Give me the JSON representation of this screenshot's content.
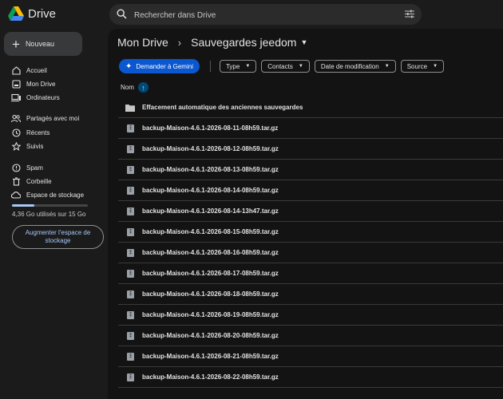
{
  "app": {
    "name": "Drive",
    "logo_colors": [
      "#0f9d58",
      "#fbbc04",
      "#4285f4",
      "#ea4335"
    ]
  },
  "search": {
    "placeholder": "Rechercher dans Drive",
    "icon": "search-icon",
    "options_icon": "tune-icon"
  },
  "sidebar": {
    "new_label": "Nouveau",
    "items": [
      {
        "label": "Accueil",
        "icon": "home-icon"
      },
      {
        "label": "Mon Drive",
        "icon": "my-drive-icon"
      },
      {
        "label": "Ordinateurs",
        "icon": "computers-icon"
      },
      {
        "label": "Partagés avec moi",
        "icon": "shared-icon"
      },
      {
        "label": "Récents",
        "icon": "clock-icon"
      },
      {
        "label": "Suivis",
        "icon": "star-icon"
      },
      {
        "label": "Spam",
        "icon": "spam-icon"
      },
      {
        "label": "Corbeille",
        "icon": "trash-icon"
      },
      {
        "label": "Espace de stockage",
        "icon": "cloud-icon"
      }
    ],
    "storage": {
      "used_text": "4,36 Go utilisés sur 15 Go",
      "used_fraction": 0.29
    },
    "upgrade_label": "Augmenter l'espace de stockage"
  },
  "breadcrumb": {
    "root": "Mon Drive",
    "separator": "›",
    "current": "Sauvegardes jeedom"
  },
  "filters": {
    "gemini_label": "Demander à Gemini",
    "chips": [
      "Type",
      "Contacts",
      "Date de modification",
      "Source"
    ]
  },
  "table": {
    "name_header": "Nom",
    "rows": [
      {
        "name": "Effacement automatique des anciennes sauvegardes",
        "kind": "folder"
      },
      {
        "name": "backup-Maison-4.6.1-2026-08-11-08h59.tar.gz",
        "kind": "file"
      },
      {
        "name": "backup-Maison-4.6.1-2026-08-12-08h59.tar.gz",
        "kind": "file"
      },
      {
        "name": "backup-Maison-4.6.1-2026-08-13-08h59.tar.gz",
        "kind": "file"
      },
      {
        "name": "backup-Maison-4.6.1-2026-08-14-08h59.tar.gz",
        "kind": "file"
      },
      {
        "name": "backup-Maison-4.6.1-2026-08-14-13h47.tar.gz",
        "kind": "file"
      },
      {
        "name": "backup-Maison-4.6.1-2026-08-15-08h59.tar.gz",
        "kind": "file"
      },
      {
        "name": "backup-Maison-4.6.1-2026-08-16-08h59.tar.gz",
        "kind": "file"
      },
      {
        "name": "backup-Maison-4.6.1-2026-08-17-08h59.tar.gz",
        "kind": "file"
      },
      {
        "name": "backup-Maison-4.6.1-2026-08-18-08h59.tar.gz",
        "kind": "file"
      },
      {
        "name": "backup-Maison-4.6.1-2026-08-19-08h59.tar.gz",
        "kind": "file"
      },
      {
        "name": "backup-Maison-4.6.1-2026-08-20-08h59.tar.gz",
        "kind": "file"
      },
      {
        "name": "backup-Maison-4.6.1-2026-08-21-08h59.tar.gz",
        "kind": "file"
      },
      {
        "name": "backup-Maison-4.6.1-2026-08-22-08h59.tar.gz",
        "kind": "file"
      }
    ]
  },
  "colors": {
    "background": "#1b1b1b",
    "main_panel": "#131314",
    "accent": "#0b57d0",
    "link": "#a8c7fa"
  }
}
